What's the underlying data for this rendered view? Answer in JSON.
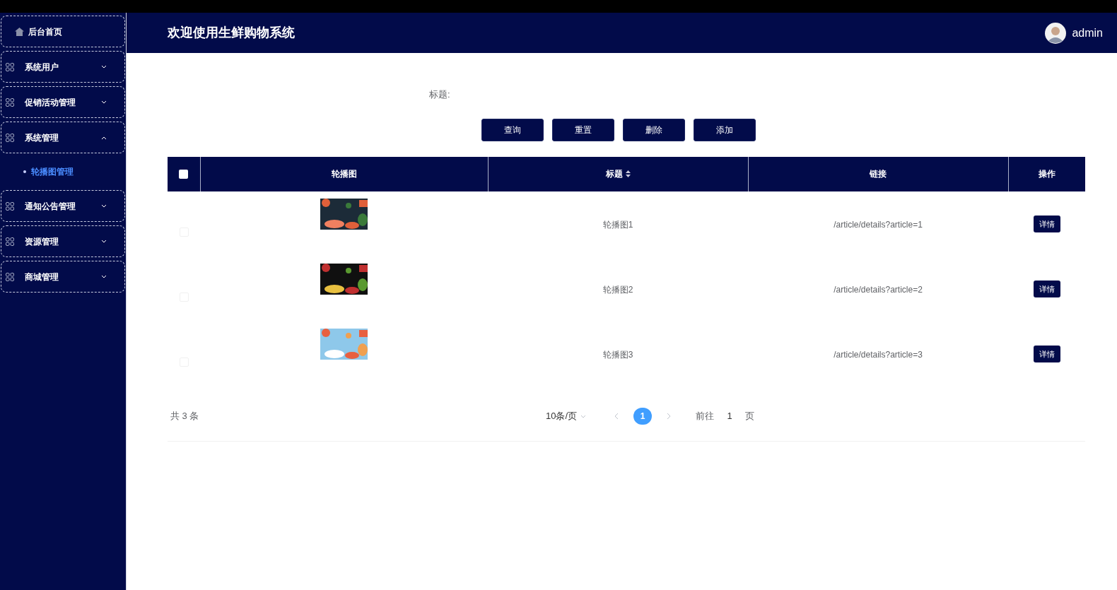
{
  "header": {
    "title": "欢迎使用生鲜购物系统",
    "user": "admin"
  },
  "sidebar": {
    "items": [
      {
        "kind": "home",
        "label": "后台首页"
      },
      {
        "kind": "group",
        "label": "系统用户",
        "expanded": false
      },
      {
        "kind": "group",
        "label": "促销活动管理",
        "expanded": false
      },
      {
        "kind": "group",
        "label": "系统管理",
        "expanded": true,
        "children": [
          {
            "label": "轮播图管理",
            "selected": true
          }
        ]
      },
      {
        "kind": "group",
        "label": "通知公告管理",
        "expanded": false
      },
      {
        "kind": "group",
        "label": "资源管理",
        "expanded": false
      },
      {
        "kind": "group",
        "label": "商城管理",
        "expanded": false
      }
    ]
  },
  "search": {
    "label": "标题:"
  },
  "buttons": [
    "查询",
    "重置",
    "删除",
    "添加"
  ],
  "table": {
    "select_all": {
      "checked": false
    },
    "columns": [
      {
        "label": "轮播图",
        "sortable": false
      },
      {
        "label": "标题",
        "sortable": true
      },
      {
        "label": "链接",
        "sortable": false
      },
      {
        "label": "操作",
        "sortable": false
      }
    ],
    "rows": [
      {
        "checked": false,
        "title": "轮播图1",
        "link": "/article/details?article=1",
        "action": "详情"
      },
      {
        "checked": false,
        "title": "轮播图2",
        "link": "/article/details?article=2",
        "action": "详情"
      },
      {
        "checked": false,
        "title": "轮播图3",
        "link": "/article/details?article=3",
        "action": "详情"
      }
    ]
  },
  "pagination": {
    "total": "共 3 条",
    "page_size": "10条/页",
    "pages": [
      {
        "label": "1",
        "selected": true
      }
    ],
    "goto_label": "前往",
    "goto_value": "1",
    "page_suffix": "页"
  }
}
